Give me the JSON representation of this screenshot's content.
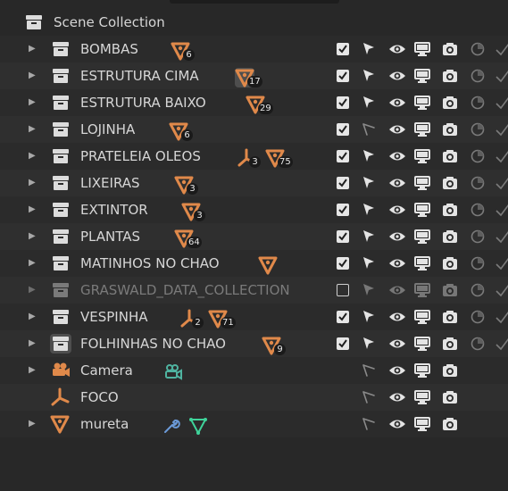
{
  "outliner": {
    "root": {
      "label": "Scene Collection",
      "icon": "scene-collection-icon"
    },
    "rows": [
      {
        "name": "BOMBAS",
        "type": "collection",
        "children": [
          {
            "icon": "mesh-cone-icon",
            "count": "6"
          }
        ],
        "enabled": true
      },
      {
        "name": "ESTRUTURA CIMA",
        "type": "collection",
        "children": [
          {
            "icon": "mesh-cone-icon",
            "count": "17",
            "highlighted": true
          }
        ],
        "enabled": true
      },
      {
        "name": "ESTRUTURA BAIXO",
        "type": "collection",
        "children": [
          {
            "icon": "mesh-cone-icon",
            "count": "29"
          }
        ],
        "enabled": true
      },
      {
        "name": "LOJINHA",
        "type": "collection",
        "children": [
          {
            "icon": "mesh-cone-icon",
            "count": "6"
          }
        ],
        "enabled": true,
        "selectable": false
      },
      {
        "name": "PRATELEIA OLEOS",
        "type": "collection",
        "children": [
          {
            "icon": "empty-axes-icon",
            "count": "3"
          },
          {
            "icon": "mesh-cone-icon",
            "count": "75"
          }
        ],
        "enabled": true
      },
      {
        "name": "LIXEIRAS",
        "type": "collection",
        "children": [
          {
            "icon": "mesh-cone-icon",
            "count": "3"
          }
        ],
        "enabled": true
      },
      {
        "name": "EXTINTOR",
        "type": "collection",
        "children": [
          {
            "icon": "mesh-cone-icon",
            "count": "3"
          }
        ],
        "enabled": true
      },
      {
        "name": "PLANTAS",
        "type": "collection",
        "children": [
          {
            "icon": "mesh-cone-icon",
            "count": "64"
          }
        ],
        "enabled": true
      },
      {
        "name": "MATINHOS NO CHAO",
        "type": "collection",
        "children": [
          {
            "icon": "mesh-cone-icon",
            "count": ""
          }
        ],
        "enabled": true
      },
      {
        "name": "GRASWALD_DATA_COLLECTION",
        "type": "collection",
        "children": [],
        "enabled": false
      },
      {
        "name": "VESPINHA",
        "type": "collection",
        "children": [
          {
            "icon": "empty-axes-icon",
            "count": "2"
          },
          {
            "icon": "mesh-cone-icon",
            "count": "71"
          }
        ],
        "enabled": true
      },
      {
        "name": "FOLHINHAS NO CHAO",
        "type": "collection",
        "children": [
          {
            "icon": "mesh-cone-icon",
            "count": "9"
          }
        ],
        "enabled": true,
        "icon_highlighted": true
      },
      {
        "name": "Camera",
        "type": "object-camera",
        "children": [
          {
            "icon": "camera-data-icon",
            "count": ""
          }
        ],
        "enabled": null
      },
      {
        "name": "FOCO",
        "type": "object-empty",
        "children": [],
        "enabled": null
      },
      {
        "name": "mureta",
        "type": "object-mesh",
        "children": [
          {
            "icon": "wrench-modifier-icon",
            "count": ""
          },
          {
            "icon": "mesh-data-icon",
            "count": ""
          }
        ],
        "enabled": null
      }
    ]
  },
  "colors": {
    "object_orange": "#e0894a",
    "camera_teal": "#4fb3a0",
    "modifier_blue": "#6b9ad8",
    "mesh_green": "#3fd39a"
  }
}
